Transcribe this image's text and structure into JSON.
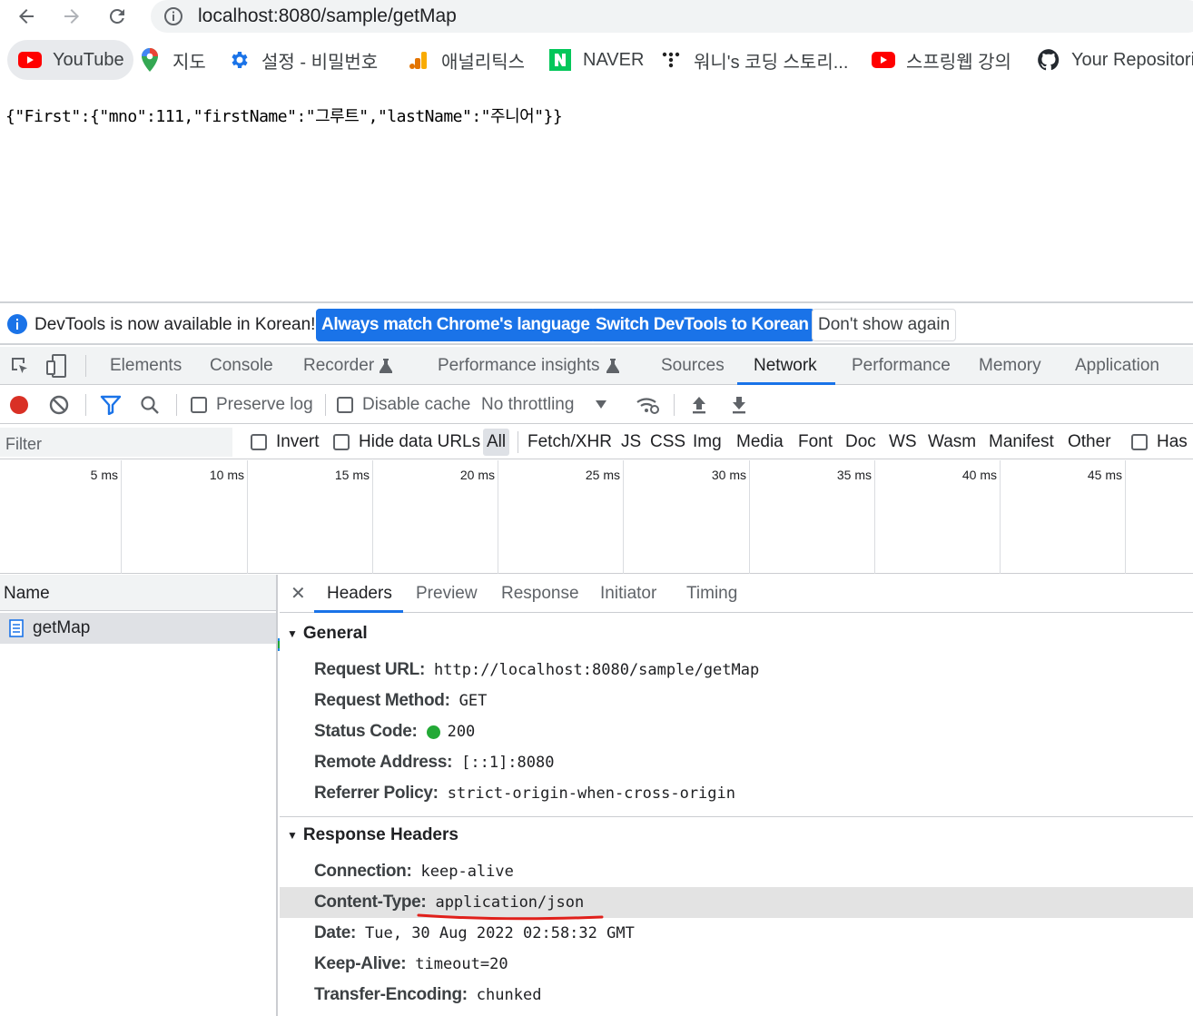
{
  "browser": {
    "url": "localhost:8080/sample/getMap",
    "bookmarks": [
      {
        "label": "YouTube",
        "icon": "youtube-icon"
      },
      {
        "label": "지도",
        "icon": "maps-pin-icon"
      },
      {
        "label": "설정 - 비밀번호",
        "icon": "settings-gear-icon"
      },
      {
        "label": "애널리틱스",
        "icon": "analytics-icon"
      },
      {
        "label": "NAVER",
        "icon": "naver-icon"
      },
      {
        "label": "워니's 코딩 스토리...",
        "icon": "dots-icon"
      },
      {
        "label": "스프링웹 강의",
        "icon": "youtube-icon"
      },
      {
        "label": "Your Repositorie",
        "icon": "github-icon"
      }
    ]
  },
  "page": {
    "json_text": "{\"First\":{\"mno\":111,\"firstName\":\"그루트\",\"lastName\":\"주니어\"}}"
  },
  "devtools": {
    "infobar": {
      "message": "DevTools is now available in Korean!",
      "btn_match": "Always match Chrome's language",
      "btn_switch": "Switch DevTools to Korean",
      "btn_dismiss": "Don't show again"
    },
    "tabs": [
      "Elements",
      "Console",
      "Recorder",
      "Performance insights",
      "Sources",
      "Network",
      "Performance",
      "Memory",
      "Application"
    ],
    "active_tab": "Network",
    "toolbar": {
      "preserve_log": "Preserve log",
      "disable_cache": "Disable cache",
      "throttling": "No throttling"
    },
    "filterbar": {
      "placeholder": "Filter",
      "invert": "Invert",
      "hide_data_urls": "Hide data URLs",
      "types": [
        "All",
        "Fetch/XHR",
        "JS",
        "CSS",
        "Img",
        "Media",
        "Font",
        "Doc",
        "WS",
        "Wasm",
        "Manifest",
        "Other"
      ],
      "has_blocked": "Has b"
    },
    "timeline": {
      "ticks": [
        "5 ms",
        "10 ms",
        "15 ms",
        "20 ms",
        "25 ms",
        "30 ms",
        "35 ms",
        "40 ms",
        "45 ms"
      ],
      "request_colors": {
        "waiting": "#8a8d91",
        "download": "#1fa63a",
        "receive": "#1e88e5"
      }
    },
    "requests": {
      "header": "Name",
      "rows": [
        {
          "name": "getMap"
        }
      ]
    },
    "detail": {
      "tabs": [
        "Headers",
        "Preview",
        "Response",
        "Initiator",
        "Timing"
      ],
      "active": "Headers",
      "general_title": "General",
      "general": [
        {
          "k": "Request URL:",
          "v": "http://localhost:8080/sample/getMap"
        },
        {
          "k": "Request Method:",
          "v": "GET"
        },
        {
          "k": "Status Code:",
          "v": "200"
        },
        {
          "k": "Remote Address:",
          "v": "[::1]:8080"
        },
        {
          "k": "Referrer Policy:",
          "v": "strict-origin-when-cross-origin"
        }
      ],
      "response_title": "Response Headers",
      "response": [
        {
          "k": "Connection:",
          "v": "keep-alive"
        },
        {
          "k": "Content-Type:",
          "v": "application/json"
        },
        {
          "k": "Date:",
          "v": "Tue, 30 Aug 2022 02:58:32 GMT"
        },
        {
          "k": "Keep-Alive:",
          "v": "timeout=20"
        },
        {
          "k": "Transfer-Encoding:",
          "v": "chunked"
        }
      ]
    }
  }
}
